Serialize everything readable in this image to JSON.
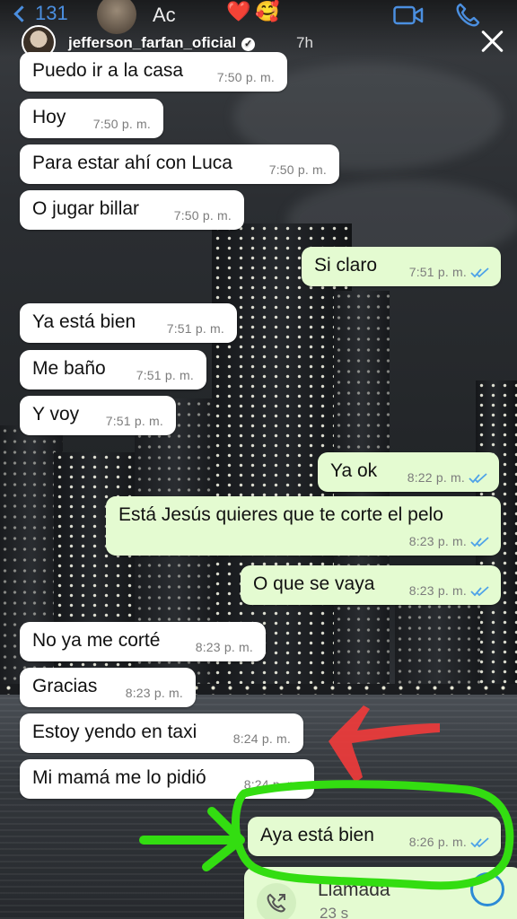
{
  "header": {
    "back_count": "131",
    "contact_name": "Ac",
    "contact_emojis": [
      "❤️",
      "🥰"
    ],
    "video_icon": "video-camera-icon",
    "phone_icon": "phone-icon"
  },
  "story": {
    "username": "jefferson_farfan_oficial",
    "verified_icon": "verified-badge-icon",
    "time_ago": "7h",
    "close_icon": "close-icon"
  },
  "messages": [
    {
      "side": "in",
      "text": "Puedo ir a la casa",
      "time": "7:50 p. m."
    },
    {
      "side": "in",
      "text": "Hoy",
      "time": "7:50 p. m."
    },
    {
      "side": "in",
      "text": "Para estar ahí con Luca",
      "time": "7:50 p. m."
    },
    {
      "side": "in",
      "text": "O jugar billar",
      "time": "7:50 p. m."
    },
    {
      "side": "out",
      "text": "Si claro",
      "time": "7:51 p. m."
    },
    {
      "side": "in",
      "text": "Ya está bien",
      "time": "7:51 p. m."
    },
    {
      "side": "in",
      "text": "Me baño",
      "time": "7:51 p. m."
    },
    {
      "side": "in",
      "text": "Y voy",
      "time": "7:51 p. m."
    },
    {
      "side": "out",
      "text": "Ya ok",
      "time": "8:22 p. m."
    },
    {
      "side": "out",
      "text": "Está Jesús quieres que te corte el pelo",
      "time": "8:23 p. m."
    },
    {
      "side": "out",
      "text": "O que se vaya",
      "time": "8:23 p. m."
    },
    {
      "side": "in",
      "text": "No ya me corté",
      "time": "8:23 p. m."
    },
    {
      "side": "in",
      "text": "Gracias",
      "time": "8:23 p. m."
    },
    {
      "side": "in",
      "text": "Estoy yendo en taxi",
      "time": "8:24 p. m."
    },
    {
      "side": "in",
      "text": "Mi mamá me lo pidió",
      "time": "8:24 p. m."
    },
    {
      "side": "out",
      "text": "Aya está bien",
      "time": "8:26 p. m."
    }
  ],
  "call": {
    "label": "Llamada",
    "duration": "23 s",
    "icon": "outgoing-call-icon"
  },
  "colors": {
    "incoming_bubble": "#ffffff",
    "outgoing_bubble": "#e4fbd1",
    "read_ticks": "#4fa3e8",
    "annotation_red": "#ee3b3b",
    "annotation_green": "#33dd11"
  }
}
